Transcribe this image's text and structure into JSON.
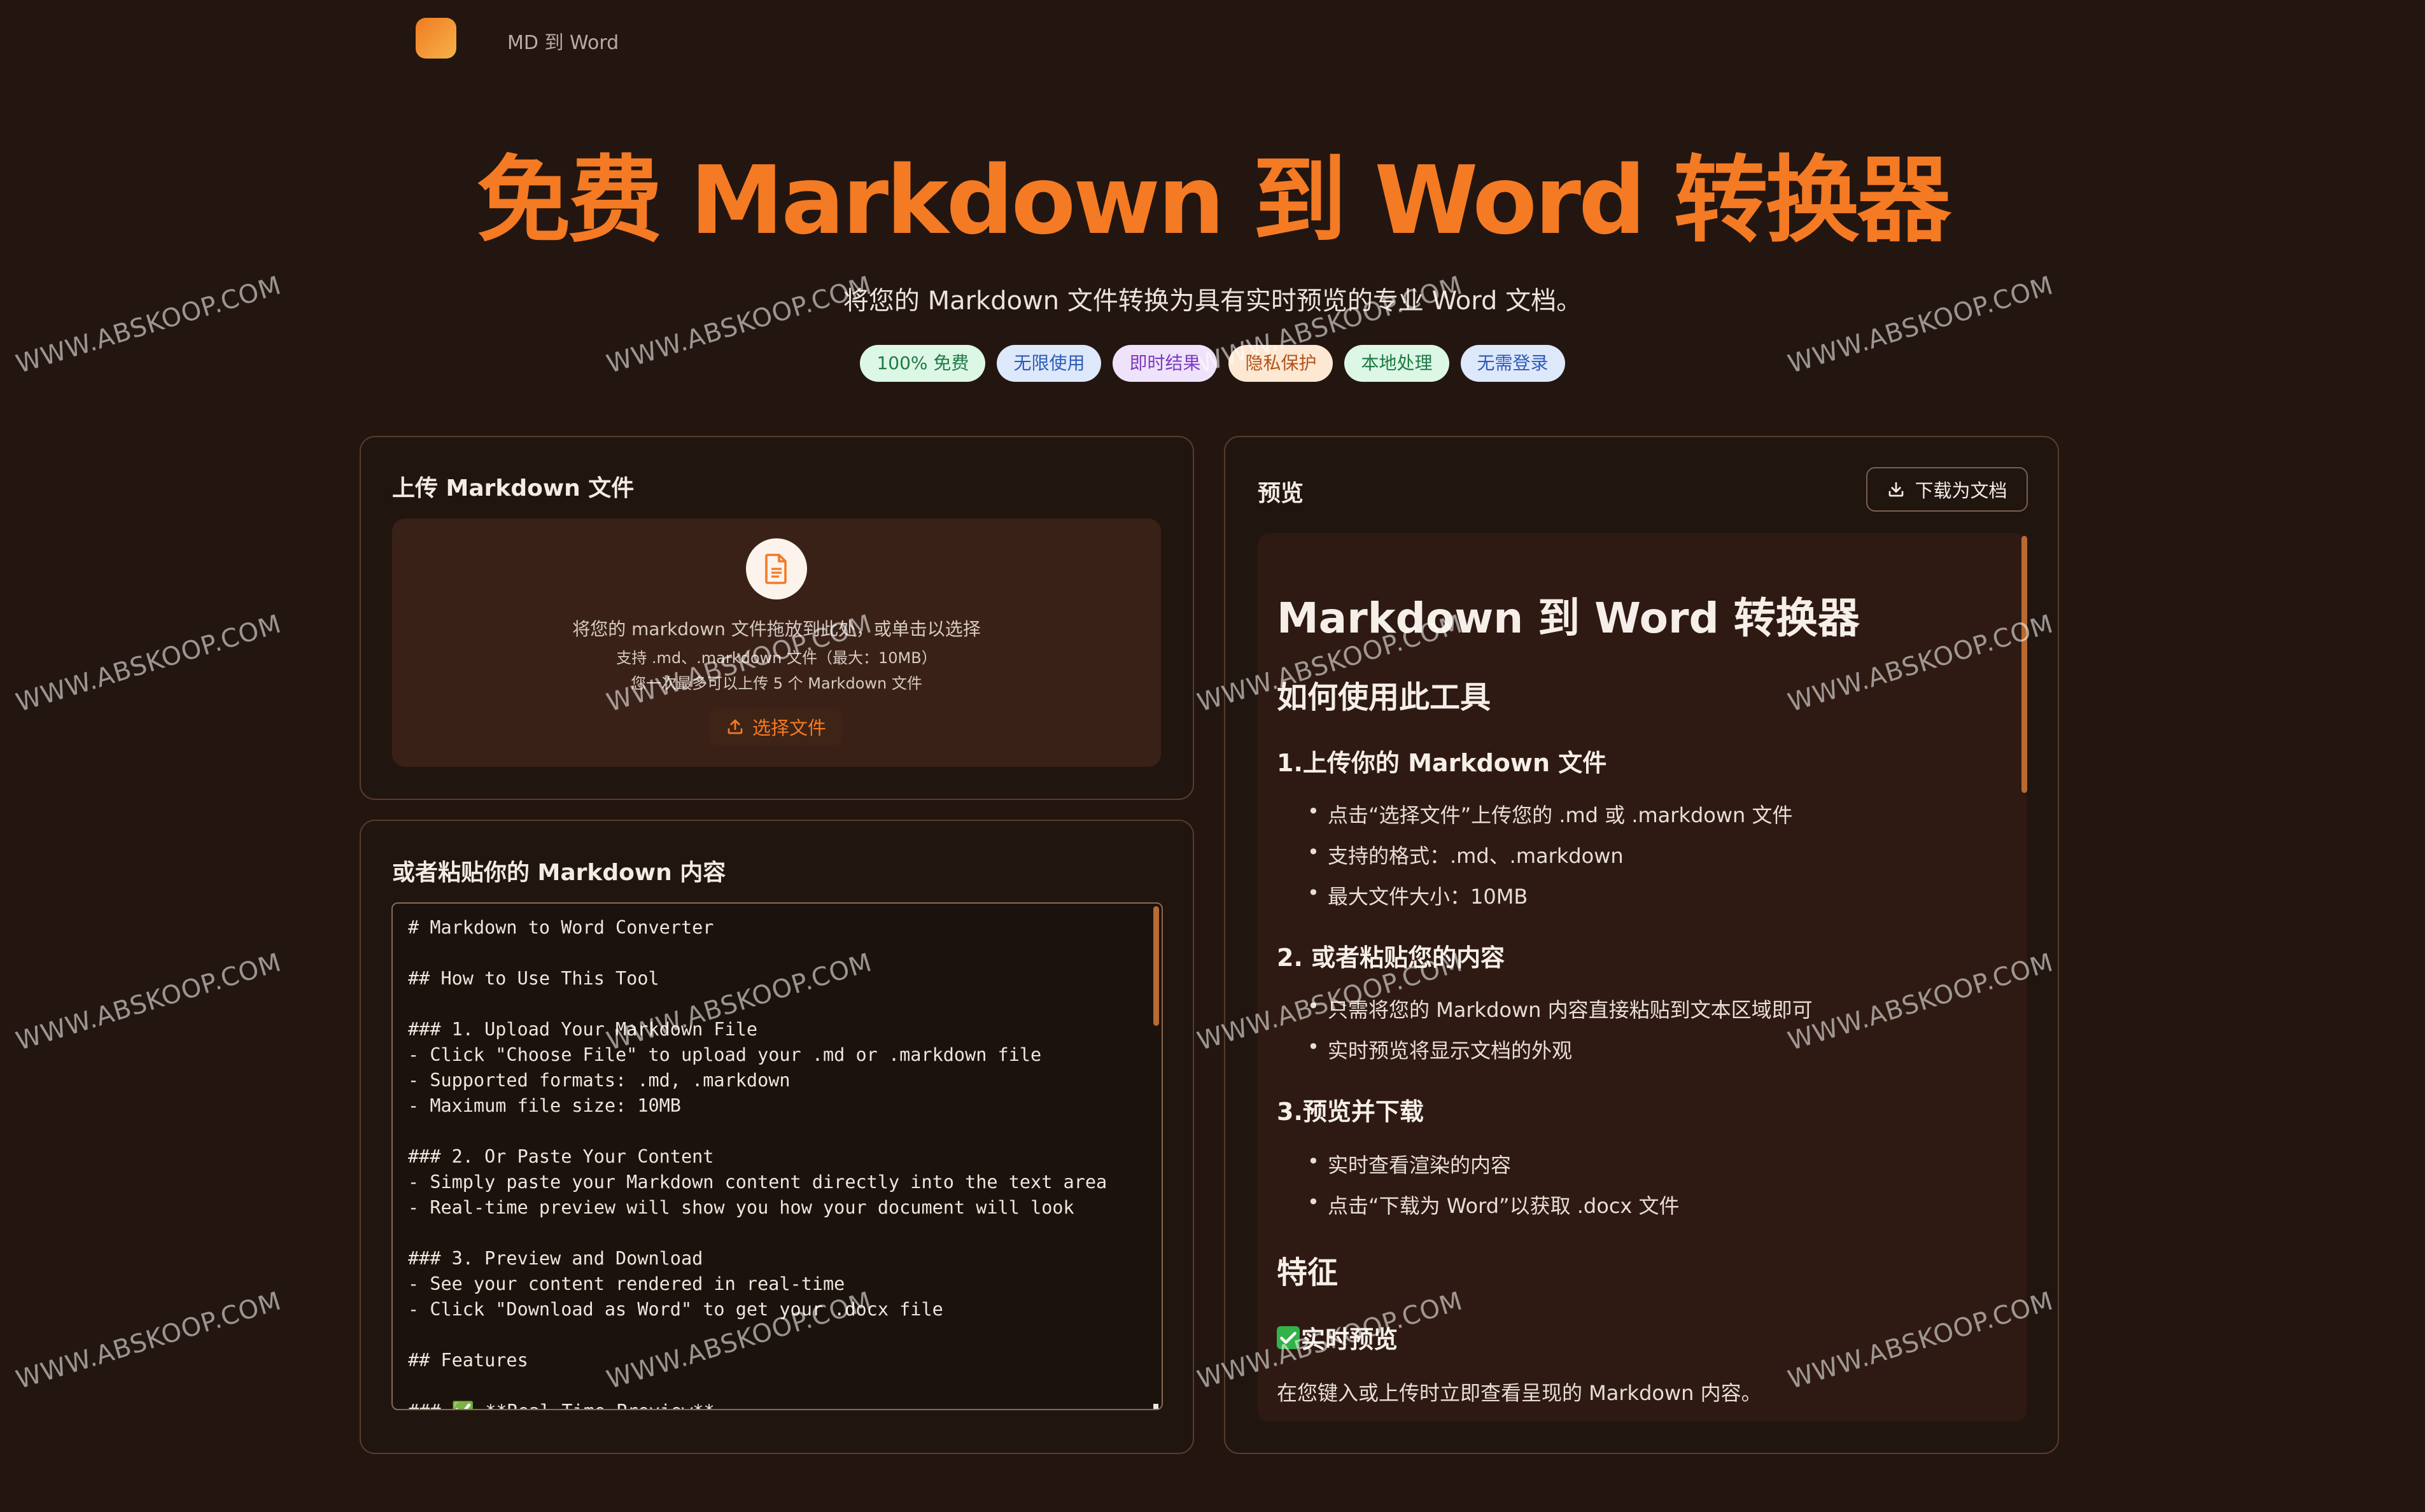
{
  "header": {
    "brand": "MD 到 Word"
  },
  "hero": {
    "title": "免费 Markdown 到 Word 转换器",
    "subtitle": "将您的 Markdown 文件转换为具有实时预览的专业 Word 文档。",
    "badges": [
      "100% 免费",
      "无限使用",
      "即时结果",
      "隐私保护",
      "本地处理",
      "无需登录"
    ]
  },
  "upload": {
    "title": "上传 Markdown 文件",
    "drop_text": "将您的 markdown 文件拖放到此处，或单击以选择",
    "support_text": "支持 .md、.markdown 文件（最大：10MB）",
    "limit_text": "您一次最多可以上传 5 个 Markdown 文件",
    "choose_label": "选择文件"
  },
  "paste": {
    "title": "或者粘贴你的 Markdown 内容",
    "content": "# Markdown to Word Converter\n\n## How to Use This Tool\n\n### 1. Upload Your Markdown File\n- Click \"Choose File\" to upload your .md or .markdown file\n- Supported formats: .md, .markdown\n- Maximum file size: 10MB\n\n### 2. Or Paste Your Content\n- Simply paste your Markdown content directly into the text area\n- Real-time preview will show you how your document will look\n\n### 3. Preview and Download\n- See your content rendered in real-time\n- Click \"Download as Word\" to get your .docx file\n\n## Features\n\n### ✅ **Real-Time Preview**"
  },
  "preview": {
    "title": "预览",
    "download_label": "下载为文档",
    "h1": "Markdown 到 Word 转换器",
    "h2_how": "如何使用此工具",
    "step1": "1.上传你的 Markdown 文件",
    "step1_items": [
      "点击“选择文件”上传您的 .md 或 .markdown 文件",
      "支持的格式：.md、.markdown",
      "最大文件大小：10MB"
    ],
    "step2": "2. 或者粘贴您的内容",
    "step2_items": [
      "只需将您的 Markdown 内容直接粘贴到文本区域即可",
      "实时预览将显示文档的外观"
    ],
    "step3": "3.预览并下载",
    "step3_items": [
      "实时查看渲染的内容",
      "点击“下载为 Word”以获取 .docx 文件"
    ],
    "h2_features": "特征",
    "feature1": "实时预览",
    "feature1_text": "在您键入或上传时立即查看呈现的 Markdown 内容。"
  },
  "watermark": "WWW.ABSKOOP.COM",
  "colors": {
    "accent": "#f47a24",
    "background": "#231610",
    "card_border": "#5a3c2a"
  }
}
